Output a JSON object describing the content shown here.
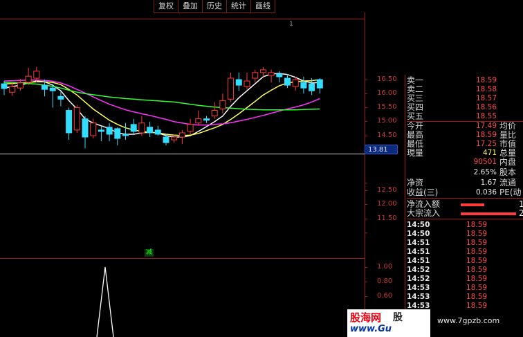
{
  "toolbar": {
    "buttons": [
      "复权",
      "叠加",
      "历史",
      "统计",
      "画线"
    ]
  },
  "main_chart": {
    "corner_mark": "1",
    "cursor_price": "13.81",
    "y_ticks": [
      "16.50",
      "16.00",
      "15.50",
      "15.00",
      "14.50"
    ],
    "candles": [
      {
        "o": 16.35,
        "c": 16.18,
        "h": 16.45,
        "l": 15.95
      },
      {
        "o": 16.05,
        "c": 16.25,
        "h": 16.4,
        "l": 15.92
      },
      {
        "o": 16.2,
        "c": 16.38,
        "h": 16.52,
        "l": 16.1
      },
      {
        "o": 16.4,
        "c": 16.62,
        "h": 16.92,
        "l": 16.3
      },
      {
        "o": 16.55,
        "c": 16.8,
        "h": 16.95,
        "l": 16.4
      },
      {
        "o": 16.3,
        "c": 16.15,
        "h": 16.5,
        "l": 15.9
      },
      {
        "o": 16.2,
        "c": 16.1,
        "h": 16.35,
        "l": 15.5
      },
      {
        "o": 15.9,
        "c": 15.8,
        "h": 16.1,
        "l": 15.55
      },
      {
        "o": 15.4,
        "c": 14.6,
        "h": 15.5,
        "l": 14.35
      },
      {
        "o": 14.7,
        "c": 15.5,
        "h": 15.6,
        "l": 14.6
      },
      {
        "o": 15.1,
        "c": 14.45,
        "h": 15.2,
        "l": 14.05
      },
      {
        "o": 14.5,
        "c": 14.95,
        "h": 15.1,
        "l": 14.4
      },
      {
        "o": 14.7,
        "c": 14.65,
        "h": 14.85,
        "l": 14.3
      },
      {
        "o": 14.8,
        "c": 14.55,
        "h": 14.95,
        "l": 14.3
      },
      {
        "o": 14.75,
        "c": 14.4,
        "h": 14.8,
        "l": 14.15
      },
      {
        "o": 14.55,
        "c": 14.5,
        "h": 14.95,
        "l": 14.35
      },
      {
        "o": 14.9,
        "c": 14.65,
        "h": 15.1,
        "l": 14.55
      },
      {
        "o": 14.6,
        "c": 14.95,
        "h": 15.2,
        "l": 14.5
      },
      {
        "o": 14.8,
        "c": 14.6,
        "h": 15.0,
        "l": 14.45
      },
      {
        "o": 14.7,
        "c": 14.55,
        "h": 14.85,
        "l": 14.5
      },
      {
        "o": 14.45,
        "c": 14.25,
        "h": 14.55,
        "l": 14.15
      },
      {
        "o": 14.35,
        "c": 14.45,
        "h": 14.55,
        "l": 14.25
      },
      {
        "o": 14.45,
        "c": 14.6,
        "h": 14.7,
        "l": 14.2
      },
      {
        "o": 14.65,
        "c": 14.9,
        "h": 15.1,
        "l": 14.55
      },
      {
        "o": 14.95,
        "c": 15.1,
        "h": 15.4,
        "l": 14.85
      },
      {
        "o": 15.1,
        "c": 15.05,
        "h": 15.2,
        "l": 14.95
      },
      {
        "o": 15.2,
        "c": 15.4,
        "h": 15.7,
        "l": 15.1
      },
      {
        "o": 15.45,
        "c": 15.75,
        "h": 16.0,
        "l": 15.3
      },
      {
        "o": 15.8,
        "c": 16.55,
        "h": 16.75,
        "l": 15.7
      },
      {
        "o": 16.5,
        "c": 16.3,
        "h": 16.75,
        "l": 16.1
      },
      {
        "o": 16.25,
        "c": 16.45,
        "h": 16.75,
        "l": 16.15
      },
      {
        "o": 16.55,
        "c": 16.75,
        "h": 16.85,
        "l": 16.4
      },
      {
        "o": 16.75,
        "c": 16.85,
        "h": 16.95,
        "l": 16.55
      },
      {
        "o": 16.65,
        "c": 16.75,
        "h": 16.85,
        "l": 16.4
      },
      {
        "o": 16.7,
        "c": 16.6,
        "h": 16.8,
        "l": 16.4
      },
      {
        "o": 16.55,
        "c": 16.3,
        "h": 16.7,
        "l": 16.2
      },
      {
        "o": 16.25,
        "c": 16.5,
        "h": 16.6,
        "l": 16.1
      },
      {
        "o": 16.4,
        "c": 16.2,
        "h": 16.6,
        "l": 16.0
      },
      {
        "o": 16.35,
        "c": 16.1,
        "h": 16.55,
        "l": 15.95
      },
      {
        "o": 16.5,
        "c": 16.2,
        "h": 16.55,
        "l": 16.0
      }
    ],
    "ma_lines": [
      {
        "color": "#ffffff",
        "values": [
          16.2,
          16.25,
          16.3,
          16.38,
          16.45,
          16.42,
          16.3,
          16.1,
          15.75,
          15.45,
          15.1,
          14.95,
          14.85,
          14.75,
          14.6,
          14.55,
          14.55,
          14.6,
          14.62,
          14.6,
          14.5,
          14.45,
          14.45,
          14.5,
          14.65,
          14.82,
          15.0,
          15.2,
          15.55,
          15.85,
          16.1,
          16.35,
          16.6,
          16.7,
          16.72,
          16.68,
          16.58,
          16.45,
          16.38,
          16.4
        ]
      },
      {
        "color": "#ffff54",
        "values": [
          16.35,
          16.36,
          16.38,
          16.4,
          16.42,
          16.42,
          16.4,
          16.32,
          16.15,
          15.95,
          15.7,
          15.45,
          15.25,
          15.05,
          14.9,
          14.78,
          14.7,
          14.65,
          14.62,
          14.6,
          14.55,
          14.52,
          14.5,
          14.52,
          14.58,
          14.68,
          14.78,
          14.9,
          15.08,
          15.28,
          15.5,
          15.72,
          15.95,
          16.12,
          16.28,
          16.38,
          16.42,
          16.45,
          16.46,
          16.5
        ]
      },
      {
        "color": "#ff33ff",
        "values": [
          16.45,
          16.46,
          16.47,
          16.48,
          16.48,
          16.47,
          16.44,
          16.38,
          16.28,
          16.15,
          16.02,
          15.88,
          15.75,
          15.62,
          15.52,
          15.42,
          15.35,
          15.28,
          15.22,
          15.15,
          15.08,
          15.0,
          14.95,
          14.9,
          14.88,
          14.88,
          14.9,
          14.92,
          14.96,
          15.02,
          15.08,
          15.15,
          15.22,
          15.3,
          15.38,
          15.45,
          15.52,
          15.6,
          15.7,
          15.82
        ]
      },
      {
        "color": "#33ff33",
        "values": [
          16.4,
          16.4,
          16.38,
          16.36,
          16.34,
          16.3,
          16.26,
          16.2,
          16.12,
          16.05,
          16.0,
          15.96,
          15.92,
          15.88,
          15.85,
          15.82,
          15.8,
          15.78,
          15.76,
          15.74,
          15.72,
          15.7,
          15.66,
          15.62,
          15.58,
          15.55,
          15.52,
          15.5,
          15.48,
          15.46,
          15.44,
          15.43,
          15.42,
          15.42,
          15.42,
          15.42,
          15.42,
          15.43,
          15.44,
          15.45
        ]
      }
    ]
  },
  "sub_chart1": {
    "y_ticks": [
      "12.50",
      "12.00",
      "11.50"
    ]
  },
  "sub_chart2": {
    "label": "减",
    "y_ticks": [
      "1.00",
      "0.80",
      "0.60"
    ]
  },
  "quote_panel": {
    "rows": [
      {
        "label": "卖一",
        "value": "18.59"
      },
      {
        "label": "卖二",
        "value": "18.58"
      },
      {
        "label": "买三",
        "value": "18.57"
      },
      {
        "label": "买四",
        "value": "18.56"
      },
      {
        "label": "买五",
        "value": "18.55"
      },
      {
        "label": "今开",
        "value": "17.49",
        "extra": "均价"
      },
      {
        "label": "最高",
        "value": "18.59",
        "extra": "量比"
      },
      {
        "label": "最低",
        "value": "17.25",
        "extra": "市值"
      },
      {
        "label": "現量",
        "value": "471",
        "extra": "总量"
      },
      {
        "label": "",
        "value": "90501",
        "extra": "内盘"
      },
      {
        "label": "",
        "value": "2.65%",
        "extra": "股本"
      },
      {
        "label": "净资",
        "value": "1.67",
        "extra": "流通"
      },
      {
        "label": "收益(三)",
        "value": "0.036",
        "extra": "PE(动"
      }
    ],
    "flow": [
      {
        "label": "净流入额",
        "value": "1"
      },
      {
        "label": "大宗流入",
        "value": "2"
      }
    ],
    "ticks": [
      {
        "time": "14:50",
        "price": "18.59"
      },
      {
        "time": "14:50",
        "price": "18.59"
      },
      {
        "time": "14:51",
        "price": "18.59"
      },
      {
        "time": "14:51",
        "price": "18.59"
      },
      {
        "time": "14:51",
        "price": "18.59"
      },
      {
        "time": "14:52",
        "price": "18.59"
      },
      {
        "time": "14:52",
        "price": "18.59"
      },
      {
        "time": "14:53",
        "price": "18.59"
      },
      {
        "time": "14:53",
        "price": "18.59"
      },
      {
        "time": "14:53",
        "price": "18.59"
      }
    ]
  },
  "watermark": {
    "site_name": "股海网",
    "site_suffix": "股",
    "site_url": "www.Gu",
    "right_url": "www.7gpzb.com"
  },
  "colors": {
    "up": "#ff3c3c",
    "down": "#33ddff",
    "grid": "#a01818"
  }
}
